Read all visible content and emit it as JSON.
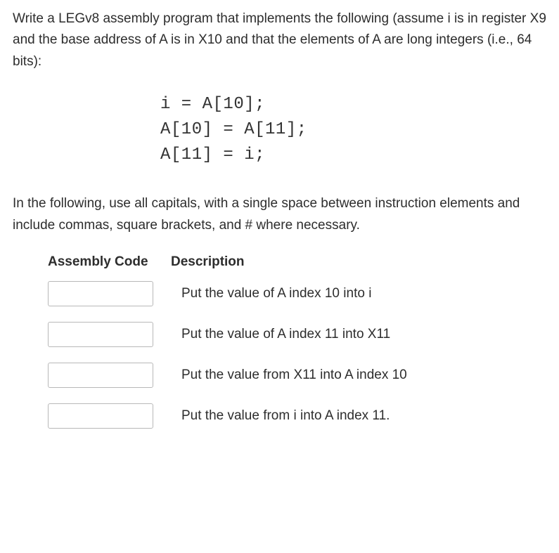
{
  "question": {
    "intro": "Write a LEGv8 assembly program that implements the following (assume i is in register X9 and the base address of A is in X10 and that the elements of A are long integers (i.e., 64 bits):"
  },
  "code": {
    "line1": "i = A[10];",
    "line2": "A[10] = A[11];",
    "line3": "A[11] = i;"
  },
  "instructions": "In the following, use all capitals, with a single space between instruction elements and include commas, square brackets, and # where necessary.",
  "table": {
    "header_code": "Assembly Code",
    "header_desc": "Description",
    "rows": [
      {
        "input": "",
        "desc": "Put the value of A index 10 into i"
      },
      {
        "input": "",
        "desc": "Put the value of A index 11 into X11"
      },
      {
        "input": "",
        "desc": "Put the value from X11 into A index 10"
      },
      {
        "input": "",
        "desc": "Put the value from i into A index 11."
      }
    ]
  }
}
